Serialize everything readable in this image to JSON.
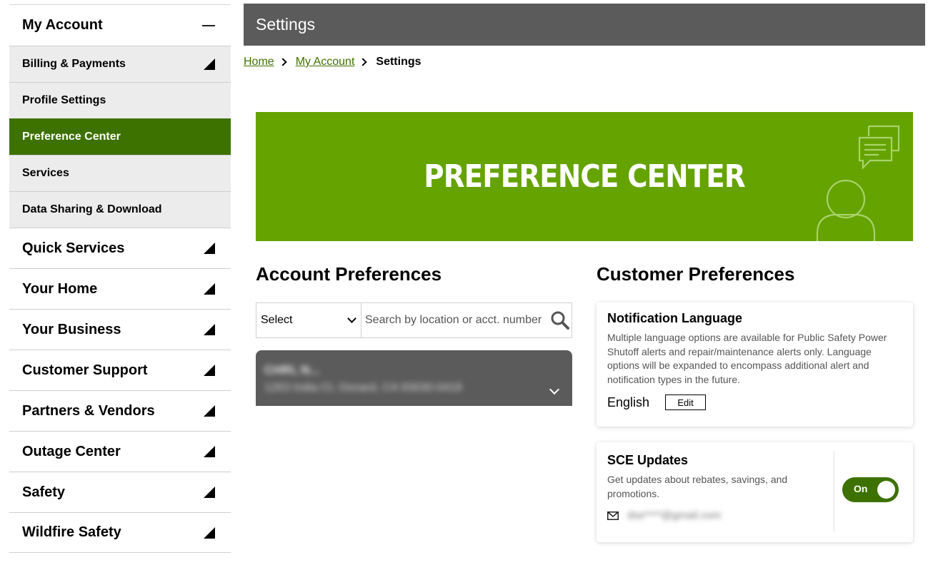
{
  "sidebar": {
    "title": "My Account",
    "sub_items": [
      {
        "label": "Billing & Payments"
      },
      {
        "label": "Profile Settings"
      },
      {
        "label": "Preference Center"
      },
      {
        "label": "Services"
      },
      {
        "label": "Data Sharing & Download"
      }
    ],
    "sections": [
      {
        "label": "Quick Services"
      },
      {
        "label": "Your Home"
      },
      {
        "label": "Your Business"
      },
      {
        "label": "Customer Support"
      },
      {
        "label": "Partners & Vendors"
      },
      {
        "label": "Outage Center"
      },
      {
        "label": "Safety"
      },
      {
        "label": "Wildfire Safety"
      }
    ]
  },
  "header": {
    "title": "Settings"
  },
  "breadcrumb": {
    "home": "Home",
    "account": "My Account",
    "current": "Settings"
  },
  "banner": {
    "title": "PREFERENCE CENTER"
  },
  "account_prefs": {
    "heading": "Account Preferences",
    "select_value": "Select",
    "search_placeholder": "Search by location or acct. number",
    "account_name": "CHRI, N...",
    "account_address": "1263 India Ct, Oxnard, CA 93030-0418"
  },
  "customer_prefs": {
    "heading": "Customer Preferences",
    "notification": {
      "title": "Notification Language",
      "description": "Multiple language options are available for Public Safety Power Shutoff alerts and repair/maintenance alerts only. Language options will be expanded to encompass additional alert and notification types in the future.",
      "language": "English",
      "edit_label": "Edit"
    },
    "sce_updates": {
      "title": "SCE Updates",
      "description": "Get updates about rebates, savings, and promotions.",
      "email": "dse****@gmail.com",
      "toggle_label": "On",
      "toggle_on": true
    }
  },
  "colors": {
    "accent_green": "#3d7100",
    "banner_green": "#65a300",
    "header_gray": "#5b5b5b"
  }
}
